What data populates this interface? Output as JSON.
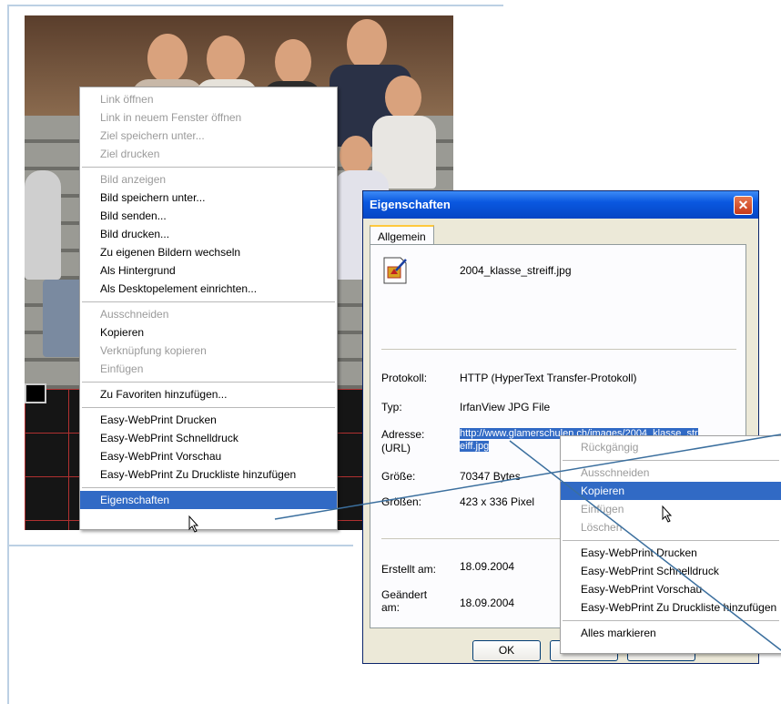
{
  "context_menu_image": {
    "items": [
      {
        "label": "Link öffnen",
        "disabled": true
      },
      {
        "label": "Link in neuem Fenster öffnen",
        "disabled": true
      },
      {
        "label": "Ziel speichern unter...",
        "disabled": true
      },
      {
        "label": "Ziel drucken",
        "disabled": true
      },
      {
        "sep": true
      },
      {
        "label": "Bild anzeigen",
        "disabled": true
      },
      {
        "label": "Bild speichern unter..."
      },
      {
        "label": "Bild senden..."
      },
      {
        "label": "Bild drucken..."
      },
      {
        "label": "Zu eigenen Bildern wechseln"
      },
      {
        "label": "Als Hintergrund"
      },
      {
        "label": "Als Desktopelement einrichten..."
      },
      {
        "sep": true
      },
      {
        "label": "Ausschneiden",
        "disabled": true
      },
      {
        "label": "Kopieren"
      },
      {
        "label": "Verknüpfung kopieren",
        "disabled": true
      },
      {
        "label": "Einfügen",
        "disabled": true
      },
      {
        "sep": true
      },
      {
        "label": "Zu Favoriten hinzufügen..."
      },
      {
        "sep": true
      },
      {
        "label": "Easy-WebPrint Drucken"
      },
      {
        "label": "Easy-WebPrint Schnelldruck"
      },
      {
        "label": "Easy-WebPrint Vorschau"
      },
      {
        "label": "Easy-WebPrint Zu Druckliste hinzufügen"
      },
      {
        "sep": true
      },
      {
        "label": "Eigenschaften",
        "selected": true
      }
    ]
  },
  "dialog": {
    "title": "Eigenschaften",
    "close_glyph": "✕",
    "tab": "Allgemein",
    "filename": "2004_klasse_streiff.jpg",
    "rows": {
      "protokoll": {
        "label": "Protokoll:",
        "value": "HTTP (HyperText Transfer-Protokoll)"
      },
      "typ": {
        "label": "Typ:",
        "value": "IrfanView JPG File"
      },
      "adresse": {
        "label": "Adresse:",
        "label2": "(URL)",
        "value1": "http://www.glamerschulen.ch/images/2004_klasse_str",
        "value2": "eiff.jpg"
      },
      "groesse": {
        "label": "Größe:",
        "value": "70347 Bytes"
      },
      "groessen": {
        "label": "Größen:",
        "value": "423 x 336 Pixel"
      },
      "erstellt": {
        "label": "Erstellt am:",
        "value": "18.09.2004"
      },
      "geaendert": {
        "label": "Geändert",
        "label2": "am:",
        "value": "18.09.2004"
      }
    },
    "ok_label": "OK"
  },
  "context_menu_text": {
    "items": [
      {
        "label": "Rückgängig",
        "disabled": true
      },
      {
        "sep": true
      },
      {
        "label": "Ausschneiden",
        "disabled": true
      },
      {
        "label": "Kopieren",
        "selected": true
      },
      {
        "label": "Einfügen",
        "disabled": true
      },
      {
        "label": "Löschen",
        "disabled": true
      },
      {
        "sep": true
      },
      {
        "label": "Easy-WebPrint Drucken"
      },
      {
        "label": "Easy-WebPrint Schnelldruck"
      },
      {
        "label": "Easy-WebPrint Vorschau"
      },
      {
        "label": "Easy-WebPrint Zu Druckliste hinzufügen"
      },
      {
        "sep": true
      },
      {
        "label": "Alles markieren"
      }
    ]
  },
  "colors": {
    "selection": "#316ac5",
    "titlebar": "#0a58e0",
    "annotation_line": "#3b6f9e"
  }
}
